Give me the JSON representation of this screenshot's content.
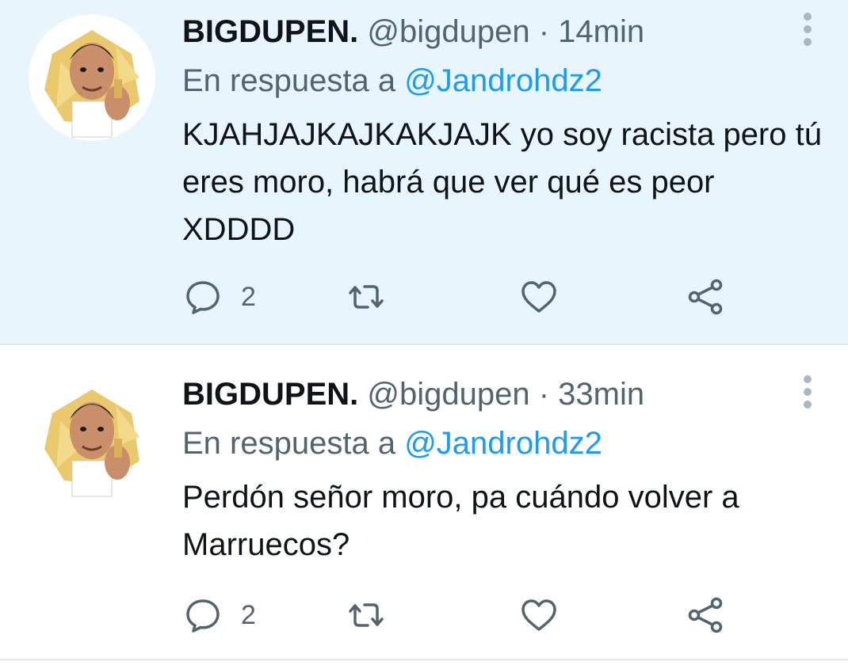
{
  "tweets": [
    {
      "name": "BIGDUPEN.",
      "handle": "@bigdupen",
      "separator": "·",
      "time": "14min",
      "reply_prefix": "En respuesta a",
      "reply_to": "@Jandrohdz2",
      "text": "KJAHJAJKAJKAKJAJK yo soy racista pero tú eres moro, habrá que ver qué es peor XDDDD",
      "reply_count": "2",
      "icons": [
        "reply-icon",
        "retweet-icon",
        "like-icon",
        "share-icon",
        "more-icon"
      ]
    },
    {
      "name": "BIGDUPEN.",
      "handle": "@bigdupen",
      "separator": "·",
      "time": "33min",
      "reply_prefix": "En respuesta a",
      "reply_to": "@Jandrohdz2",
      "text": "Perdón señor moro, pa cuándo volver a Marruecos?",
      "reply_count": "2",
      "icons": [
        "reply-icon",
        "retweet-icon",
        "like-icon",
        "share-icon",
        "more-icon"
      ]
    }
  ],
  "colors": {
    "highlight_bg": "#e8f5fd",
    "mention": "#1d9bf0",
    "secondary_text": "#536471",
    "primary_text": "#0f1419"
  }
}
